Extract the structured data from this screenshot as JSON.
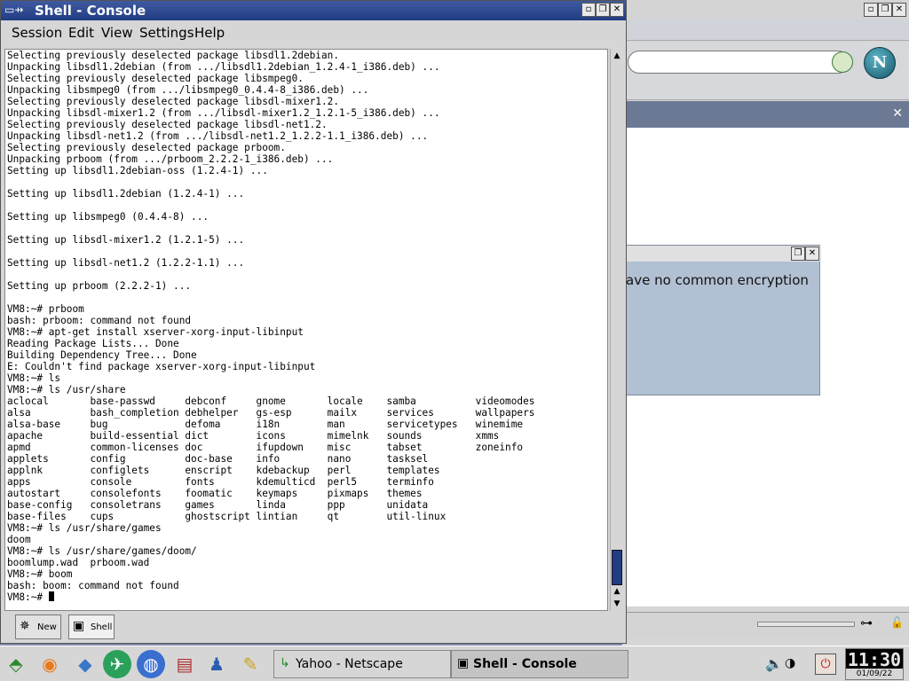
{
  "console": {
    "title": "Shell - Console",
    "menu": [
      "Session",
      "Edit",
      "View",
      "Settings",
      "Help"
    ],
    "terminal_lines": [
      "Selecting previously deselected package libsdl1.2debian.",
      "Unpacking libsdl1.2debian (from .../libsdl1.2debian_1.2.4-1_i386.deb) ...",
      "Selecting previously deselected package libsmpeg0.",
      "Unpacking libsmpeg0 (from .../libsmpeg0_0.4.4-8_i386.deb) ...",
      "Selecting previously deselected package libsdl-mixer1.2.",
      "Unpacking libsdl-mixer1.2 (from .../libsdl-mixer1.2_1.2.1-5_i386.deb) ...",
      "Selecting previously deselected package libsdl-net1.2.",
      "Unpacking libsdl-net1.2 (from .../libsdl-net1.2_1.2.2-1.1_i386.deb) ...",
      "Selecting previously deselected package prboom.",
      "Unpacking prboom (from .../prboom_2.2.2-1_i386.deb) ...",
      "Setting up libsdl1.2debian-oss (1.2.4-1) ...",
      "",
      "Setting up libsdl1.2debian (1.2.4-1) ...",
      "",
      "Setting up libsmpeg0 (0.4.4-8) ...",
      "",
      "Setting up libsdl-mixer1.2 (1.2.1-5) ...",
      "",
      "Setting up libsdl-net1.2 (1.2.2-1.1) ...",
      "",
      "Setting up prboom (2.2.2-1) ...",
      "",
      "VM8:~# prboom",
      "bash: prboom: command not found",
      "VM8:~# apt-get install xserver-xorg-input-libinput",
      "Reading Package Lists... Done",
      "Building Dependency Tree... Done",
      "E: Couldn't find package xserver-xorg-input-libinput",
      "VM8:~# ls",
      "VM8:~# ls /usr/share",
      "aclocal       base-passwd     debconf     gnome       locale    samba          videomodes",
      "alsa          bash_completion debhelper   gs-esp      mailx     services       wallpapers",
      "alsa-base     bug             defoma      i18n        man       servicetypes   winemime",
      "apache        build-essential dict        icons       mimelnk   sounds         xmms",
      "apmd          common-licenses doc         ifupdown    misc      tabset         zoneinfo",
      "applets       config          doc-base    info        nano      tasksel",
      "applnk        configlets      enscript    kdebackup   perl      templates",
      "apps          console         fonts       kdemulticd  perl5     terminfo",
      "autostart     consolefonts    foomatic    keymaps     pixmaps   themes",
      "base-config   consoletrans    games       linda       ppp       unidata",
      "base-files    cups            ghostscript lintian     qt        util-linux",
      "VM8:~# ls /usr/share/games",
      "doom",
      "VM8:~# ls /usr/share/games/doom/",
      "boomlump.wad  prboom.wad",
      "VM8:~# boom",
      "bash: boom: command not found",
      "VM8:~# "
    ],
    "tabs": [
      {
        "label": "New",
        "icon": "new-session-icon"
      },
      {
        "label": "Shell",
        "icon": "shell-icon"
      }
    ]
  },
  "netscape": {
    "logo_letter": "N"
  },
  "dialog": {
    "text": "ave no common encryption"
  },
  "taskbar": {
    "tasks": [
      {
        "label": "Yahoo - Netscape",
        "icon": "netscape-icon"
      },
      {
        "label": "Shell - Console",
        "icon": "console-icon"
      }
    ],
    "clock_time": "11:30",
    "clock_date": "01/09/22"
  }
}
